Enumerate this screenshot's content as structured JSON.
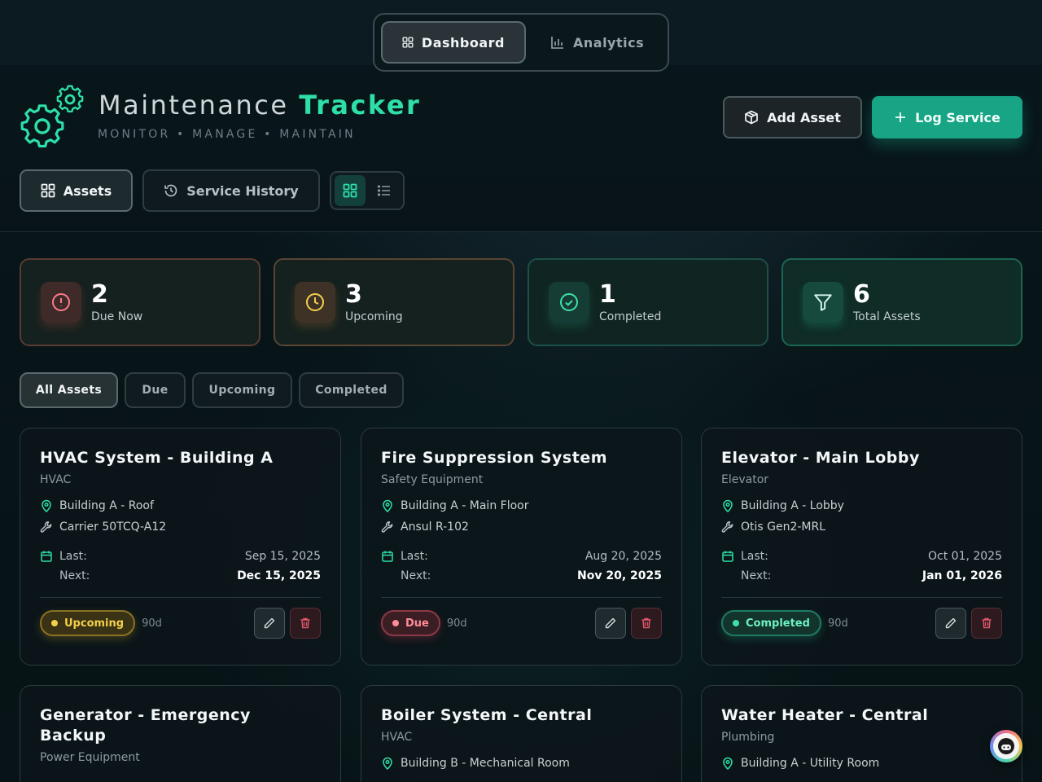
{
  "topnav": {
    "items": [
      {
        "label": "Dashboard",
        "icon": "grid-icon",
        "active": true
      },
      {
        "label": "Analytics",
        "icon": "bar-chart-icon",
        "active": false
      }
    ]
  },
  "header": {
    "title_main": "Maintenance",
    "title_accent": "Tracker",
    "subtitle": "MONITOR • MANAGE • MAINTAIN",
    "add_asset_label": "Add Asset",
    "log_service_label": "Log Service"
  },
  "tabs": {
    "assets_label": "Assets",
    "history_label": "Service History"
  },
  "view_toggle": {
    "active": "grid"
  },
  "stats": [
    {
      "value": "2",
      "label": "Due Now",
      "icon": "alert-circle-icon"
    },
    {
      "value": "3",
      "label": "Upcoming",
      "icon": "clock-icon"
    },
    {
      "value": "1",
      "label": "Completed",
      "icon": "check-circle-icon"
    },
    {
      "value": "6",
      "label": "Total Assets",
      "icon": "filter-icon"
    }
  ],
  "filters": [
    {
      "label": "All Assets",
      "active": true
    },
    {
      "label": "Due",
      "active": false
    },
    {
      "label": "Upcoming",
      "active": false
    },
    {
      "label": "Completed",
      "active": false
    }
  ],
  "assets": [
    {
      "name": "HVAC System - Building A",
      "category": "HVAC",
      "location": "Building A - Roof",
      "model": "Carrier 50TCQ-A12",
      "last_label": "Last:",
      "last": "Sep 15, 2025",
      "next_label": "Next:",
      "next": "Dec 15, 2025",
      "status": "Upcoming",
      "interval": "90d"
    },
    {
      "name": "Fire Suppression System",
      "category": "Safety Equipment",
      "location": "Building A - Main Floor",
      "model": "Ansul R-102",
      "last_label": "Last:",
      "last": "Aug 20, 2025",
      "next_label": "Next:",
      "next": "Nov 20, 2025",
      "status": "Due",
      "interval": "90d"
    },
    {
      "name": "Elevator - Main Lobby",
      "category": "Elevator",
      "location": "Building A - Lobby",
      "model": "Otis Gen2-MRL",
      "last_label": "Last:",
      "last": "Oct 01, 2025",
      "next_label": "Next:",
      "next": "Jan 01, 2026",
      "status": "Completed",
      "interval": "90d"
    },
    {
      "name": "Generator - Emergency Backup",
      "category": "Power Equipment"
    },
    {
      "name": "Boiler System - Central",
      "category": "HVAC",
      "location": "Building B - Mechanical Room"
    },
    {
      "name": "Water Heater - Central",
      "category": "Plumbing",
      "location": "Building A - Utility Room"
    }
  ],
  "colors": {
    "accent": "#2ee0a8",
    "primary_button": "#17a585",
    "due": "#ff8a98",
    "upcoming": "#f3cf4a",
    "completed": "#3fe0a6"
  }
}
